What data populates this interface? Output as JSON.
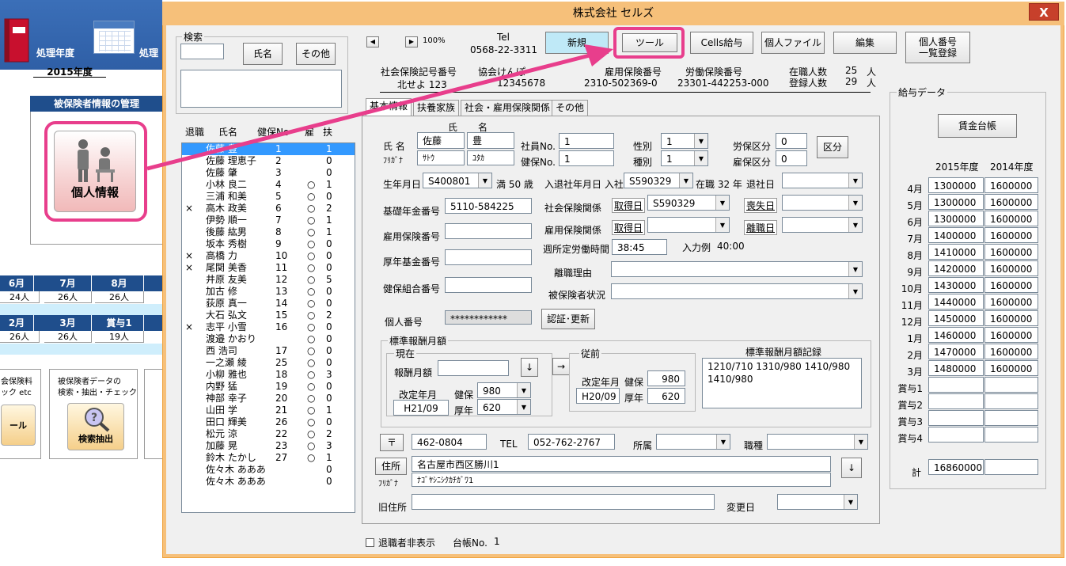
{
  "background": {
    "header_label_1": "処理年度",
    "header_label_2": "処理",
    "year_value": "2015年度",
    "panel_title": "被保険者情報の管理",
    "person_button_label": "個人情報",
    "months_row_1": [
      "6月",
      "7月",
      "8月"
    ],
    "values_row_1": [
      "24人",
      "26人",
      "26人"
    ],
    "months_row_2": [
      "2月",
      "3月",
      "賞与1"
    ],
    "values_row_2": [
      "26人",
      "26人",
      "19人"
    ],
    "box1_line1": "会保険料",
    "box1_line2": "ック etc",
    "box1_btn": "ール",
    "box2_line1": "被保険者データの",
    "box2_line2": "検索・抽出・チェック",
    "box2_btn": "検索抽出"
  },
  "window": {
    "title": "株式会社 セルズ",
    "close_label": "X"
  },
  "search": {
    "group_label": "検索",
    "name_button": "氏名",
    "other_button": "その他"
  },
  "toolbar": {
    "zoom": "100%",
    "tel_label": "Tel",
    "tel_value": "0568-22-3311",
    "new_button": "新規",
    "tool_button": "ツール",
    "cells_pay_button": "Cells給与",
    "personal_file_button": "個人ファイル",
    "edit_button": "編集",
    "my_number_button_l1": "個人番号",
    "my_number_button_l2": "一覧登録"
  },
  "company_info": {
    "social_ins_label": "社会保険記号番号",
    "social_ins_value": "北せよ 123",
    "assoc_label": "協会けんぽ",
    "assoc_value": "12345678",
    "employment_ins_label": "雇用保険番号",
    "employment_ins_value": "2310-502369-0",
    "labor_ins_label": "労働保険番号",
    "labor_ins_value": "23301-442253-000",
    "active_label": "在職人数",
    "active_value": "25",
    "registered_label": "登録人数",
    "registered_value": "29",
    "unit": "人"
  },
  "list_header": {
    "retired": "退職",
    "name": "氏名",
    "health_no": "健保No",
    "employment": "雇",
    "dependents": "扶"
  },
  "employees": [
    {
      "retired": "",
      "name": "佐藤 豊",
      "no": "1",
      "emp": "",
      "dep": "1",
      "selected": true
    },
    {
      "retired": "",
      "name": "佐藤 理恵子",
      "no": "2",
      "emp": "",
      "dep": "0"
    },
    {
      "retired": "",
      "name": "佐藤 肇",
      "no": "3",
      "emp": "",
      "dep": "0"
    },
    {
      "retired": "",
      "name": "小林 良二",
      "no": "4",
      "emp": "○",
      "dep": "1"
    },
    {
      "retired": "",
      "name": "三浦 和美",
      "no": "5",
      "emp": "○",
      "dep": "0"
    },
    {
      "retired": "×",
      "name": "高木 政美",
      "no": "6",
      "emp": "○",
      "dep": "2"
    },
    {
      "retired": "",
      "name": "伊勢 順一",
      "no": "7",
      "emp": "○",
      "dep": "1"
    },
    {
      "retired": "",
      "name": "後藤 紘男",
      "no": "8",
      "emp": "○",
      "dep": "1"
    },
    {
      "retired": "",
      "name": "坂本 秀樹",
      "no": "9",
      "emp": "○",
      "dep": "0"
    },
    {
      "retired": "×",
      "name": "高橋 力",
      "no": "10",
      "emp": "○",
      "dep": "0"
    },
    {
      "retired": "×",
      "name": "尾関 美香",
      "no": "11",
      "emp": "○",
      "dep": "0"
    },
    {
      "retired": "",
      "name": "井原 友美",
      "no": "12",
      "emp": "○",
      "dep": "5"
    },
    {
      "retired": "",
      "name": "加古 修",
      "no": "13",
      "emp": "○",
      "dep": "0"
    },
    {
      "retired": "",
      "name": "荻原 真一",
      "no": "14",
      "emp": "○",
      "dep": "0"
    },
    {
      "retired": "",
      "name": "大石 弘文",
      "no": "15",
      "emp": "○",
      "dep": "2"
    },
    {
      "retired": "×",
      "name": "志平 小雪",
      "no": "16",
      "emp": "○",
      "dep": "0"
    },
    {
      "retired": "",
      "name": "渡邉 かおり",
      "no": "",
      "emp": "○",
      "dep": "0"
    },
    {
      "retired": "",
      "name": "西 浩司",
      "no": "17",
      "emp": "○",
      "dep": "0"
    },
    {
      "retired": "",
      "name": "一之瀬 綾",
      "no": "25",
      "emp": "○",
      "dep": "0"
    },
    {
      "retired": "",
      "name": "小柳 雅也",
      "no": "18",
      "emp": "○",
      "dep": "3"
    },
    {
      "retired": "",
      "name": "内野 猛",
      "no": "19",
      "emp": "○",
      "dep": "0"
    },
    {
      "retired": "",
      "name": "神部 幸子",
      "no": "20",
      "emp": "○",
      "dep": "0"
    },
    {
      "retired": "",
      "name": "山田 学",
      "no": "21",
      "emp": "○",
      "dep": "1"
    },
    {
      "retired": "",
      "name": "田口 輝美",
      "no": "26",
      "emp": "○",
      "dep": "0"
    },
    {
      "retired": "",
      "name": "松元 涼",
      "no": "22",
      "emp": "○",
      "dep": "2"
    },
    {
      "retired": "",
      "name": "加藤 晃",
      "no": "23",
      "emp": "○",
      "dep": "3"
    },
    {
      "retired": "",
      "name": "鈴木 たかし",
      "no": "27",
      "emp": "○",
      "dep": "1"
    },
    {
      "retired": "",
      "name": "佐々木 あああ",
      "no": "",
      "emp": "",
      "dep": "0"
    },
    {
      "retired": "",
      "name": "佐々木 あああ",
      "no": "",
      "emp": "",
      "dep": "0"
    }
  ],
  "tabs": [
    "基本情報",
    "扶養家族",
    "社会・雇用保険関係",
    "その他"
  ],
  "form": {
    "surname_header": "氏",
    "given_header": "名",
    "name_label": "氏 名",
    "kana_label": "ﾌﾘｶﾞﾅ",
    "surname": "佐藤",
    "given": "豊",
    "surname_kana": "ｻﾄｳ",
    "given_kana": "ﾕﾀｶ",
    "emp_no_label": "社員No.",
    "emp_no": "1",
    "health_no_label": "健保No.",
    "health_no": "1",
    "sex_label": "性別",
    "sex": "1",
    "type_label": "種別",
    "type": "1",
    "labor_class_label": "労保区分",
    "labor_class": "0",
    "emp_class_label": "雇保区分",
    "emp_class": "0",
    "class_button": "区分",
    "birth_label": "生年月日",
    "birth": "S400801",
    "age_label": "満 50 歳",
    "join_label": "入退社年月日 入社",
    "join": "S590329",
    "tenure": "在職 32 年",
    "leave_label": "退社日",
    "leave": "",
    "pension_label": "基礎年金番号",
    "pension": "5110-584225",
    "social_rel_label": "社会保険関係",
    "acquire_link": "取得日",
    "social_acquire": "S590329",
    "lose_link": "喪失日",
    "employment_ins_label": "雇用保険番号",
    "employment_rel_label": "雇用保険関係",
    "acquire_link2": "取得日",
    "leave_link": "離職日",
    "weekly_hours_label": "週所定労働時間",
    "weekly_hours": "38:45",
    "example_label": "入力例",
    "example_value": "40:00",
    "welfare_fund_label": "厚年基金番号",
    "leave_reason_label": "離職理由",
    "health_union_label": "健保組合番号",
    "insured_status_label": "被保険者状況",
    "my_number_label": "個人番号",
    "my_number": "************",
    "auth_button": "認証･更新"
  },
  "standard_pay": {
    "group_label": "標準報酬月額",
    "current_label": "現在",
    "monthly_label": "報酬月額",
    "down_arrow": "↓",
    "right_arrow": "→",
    "revision_label": "改定年月",
    "revision": "H21/09",
    "health_label": "健保",
    "health": "980",
    "pension_label": "厚年",
    "pension": "620",
    "previous_label": "従前",
    "prev_revision_label": "改定年月",
    "prev_revision": "H20/09",
    "prev_health_label": "健保",
    "prev_health": "980",
    "prev_pension_label": "厚年",
    "prev_pension": "620",
    "record_label": "標準報酬月額記録",
    "record_line1": "1210/710  1310/980 1410/980",
    "record_line2": "1410/980"
  },
  "address": {
    "postal_button": "〒",
    "postal": "462-0804",
    "tel_label": "TEL",
    "tel": "052-762-2767",
    "dept_label": "所属",
    "job_label": "職種",
    "address_button": "住所",
    "kana_label": "ﾌﾘｶﾞﾅ",
    "address": "名古屋市西区勝川1",
    "address_kana": "ﾅｺﾞﾔｼﾆｼｸｶﾁｶﾞﾜ1",
    "down_arrow": "↓",
    "old_address_label": "旧住所",
    "change_date_label": "変更日"
  },
  "footer": {
    "hide_retired_label": "退職者非表示",
    "ledger_label": "台帳No.",
    "ledger_no": "1"
  },
  "pay_data": {
    "group_label": "給与データ",
    "ledger_button": "賃金台帳",
    "col1_header": "2015年度",
    "col2_header": "2014年度",
    "rows": [
      {
        "label": "4月",
        "v1": "1300000",
        "v2": "1600000"
      },
      {
        "label": "5月",
        "v1": "1300000",
        "v2": "1600000"
      },
      {
        "label": "6月",
        "v1": "1300000",
        "v2": "1600000"
      },
      {
        "label": "7月",
        "v1": "1400000",
        "v2": "1600000"
      },
      {
        "label": "8月",
        "v1": "1410000",
        "v2": "1600000"
      },
      {
        "label": "9月",
        "v1": "1420000",
        "v2": "1600000"
      },
      {
        "label": "10月",
        "v1": "1430000",
        "v2": "1600000"
      },
      {
        "label": "11月",
        "v1": "1440000",
        "v2": "1600000"
      },
      {
        "label": "12月",
        "v1": "1450000",
        "v2": "1600000"
      },
      {
        "label": "1月",
        "v1": "1460000",
        "v2": "1600000"
      },
      {
        "label": "2月",
        "v1": "1470000",
        "v2": "1600000"
      },
      {
        "label": "3月",
        "v1": "1480000",
        "v2": "1600000"
      },
      {
        "label": "賞与1",
        "v1": "",
        "v2": ""
      },
      {
        "label": "賞与2",
        "v1": "",
        "v2": ""
      },
      {
        "label": "賞与3",
        "v1": "",
        "v2": ""
      },
      {
        "label": "賞与4",
        "v1": "",
        "v2": ""
      }
    ],
    "total_label": "計",
    "total_v1": "16860000",
    "total_v2": ""
  },
  "colors": {
    "highlight": "#e83e8c",
    "title_bar": "#f6c07a",
    "selection": "#3399ff",
    "sheet_blue": "#1f4e8c"
  }
}
